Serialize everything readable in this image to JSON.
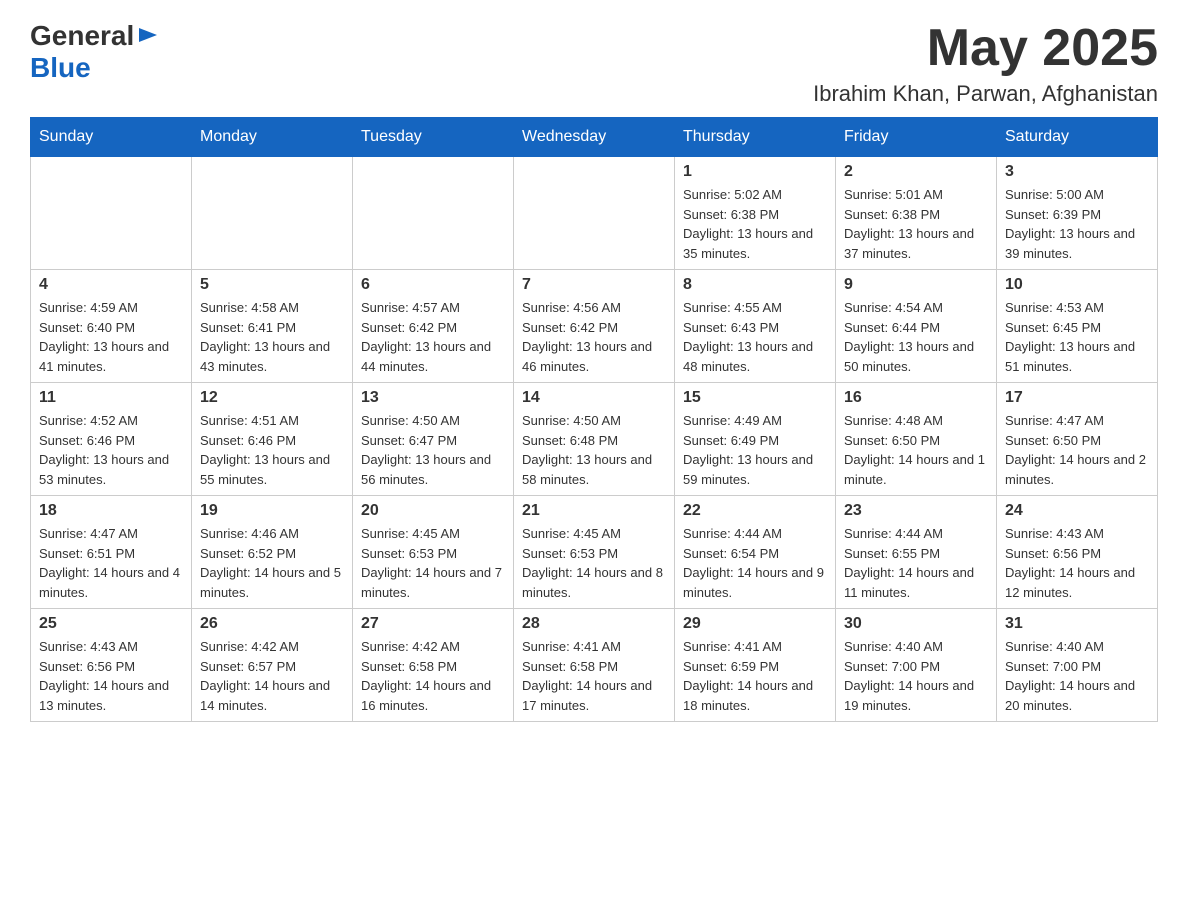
{
  "header": {
    "logo": {
      "text1": "General",
      "text2": "Blue"
    },
    "month": "May 2025",
    "location": "Ibrahim Khan, Parwan, Afghanistan"
  },
  "weekdays": [
    "Sunday",
    "Monday",
    "Tuesday",
    "Wednesday",
    "Thursday",
    "Friday",
    "Saturday"
  ],
  "weeks": [
    [
      {
        "day": "",
        "sunrise": "",
        "sunset": "",
        "daylight": ""
      },
      {
        "day": "",
        "sunrise": "",
        "sunset": "",
        "daylight": ""
      },
      {
        "day": "",
        "sunrise": "",
        "sunset": "",
        "daylight": ""
      },
      {
        "day": "",
        "sunrise": "",
        "sunset": "",
        "daylight": ""
      },
      {
        "day": "1",
        "sunrise": "Sunrise: 5:02 AM",
        "sunset": "Sunset: 6:38 PM",
        "daylight": "Daylight: 13 hours and 35 minutes."
      },
      {
        "day": "2",
        "sunrise": "Sunrise: 5:01 AM",
        "sunset": "Sunset: 6:38 PM",
        "daylight": "Daylight: 13 hours and 37 minutes."
      },
      {
        "day": "3",
        "sunrise": "Sunrise: 5:00 AM",
        "sunset": "Sunset: 6:39 PM",
        "daylight": "Daylight: 13 hours and 39 minutes."
      }
    ],
    [
      {
        "day": "4",
        "sunrise": "Sunrise: 4:59 AM",
        "sunset": "Sunset: 6:40 PM",
        "daylight": "Daylight: 13 hours and 41 minutes."
      },
      {
        "day": "5",
        "sunrise": "Sunrise: 4:58 AM",
        "sunset": "Sunset: 6:41 PM",
        "daylight": "Daylight: 13 hours and 43 minutes."
      },
      {
        "day": "6",
        "sunrise": "Sunrise: 4:57 AM",
        "sunset": "Sunset: 6:42 PM",
        "daylight": "Daylight: 13 hours and 44 minutes."
      },
      {
        "day": "7",
        "sunrise": "Sunrise: 4:56 AM",
        "sunset": "Sunset: 6:42 PM",
        "daylight": "Daylight: 13 hours and 46 minutes."
      },
      {
        "day": "8",
        "sunrise": "Sunrise: 4:55 AM",
        "sunset": "Sunset: 6:43 PM",
        "daylight": "Daylight: 13 hours and 48 minutes."
      },
      {
        "day": "9",
        "sunrise": "Sunrise: 4:54 AM",
        "sunset": "Sunset: 6:44 PM",
        "daylight": "Daylight: 13 hours and 50 minutes."
      },
      {
        "day": "10",
        "sunrise": "Sunrise: 4:53 AM",
        "sunset": "Sunset: 6:45 PM",
        "daylight": "Daylight: 13 hours and 51 minutes."
      }
    ],
    [
      {
        "day": "11",
        "sunrise": "Sunrise: 4:52 AM",
        "sunset": "Sunset: 6:46 PM",
        "daylight": "Daylight: 13 hours and 53 minutes."
      },
      {
        "day": "12",
        "sunrise": "Sunrise: 4:51 AM",
        "sunset": "Sunset: 6:46 PM",
        "daylight": "Daylight: 13 hours and 55 minutes."
      },
      {
        "day": "13",
        "sunrise": "Sunrise: 4:50 AM",
        "sunset": "Sunset: 6:47 PM",
        "daylight": "Daylight: 13 hours and 56 minutes."
      },
      {
        "day": "14",
        "sunrise": "Sunrise: 4:50 AM",
        "sunset": "Sunset: 6:48 PM",
        "daylight": "Daylight: 13 hours and 58 minutes."
      },
      {
        "day": "15",
        "sunrise": "Sunrise: 4:49 AM",
        "sunset": "Sunset: 6:49 PM",
        "daylight": "Daylight: 13 hours and 59 minutes."
      },
      {
        "day": "16",
        "sunrise": "Sunrise: 4:48 AM",
        "sunset": "Sunset: 6:50 PM",
        "daylight": "Daylight: 14 hours and 1 minute."
      },
      {
        "day": "17",
        "sunrise": "Sunrise: 4:47 AM",
        "sunset": "Sunset: 6:50 PM",
        "daylight": "Daylight: 14 hours and 2 minutes."
      }
    ],
    [
      {
        "day": "18",
        "sunrise": "Sunrise: 4:47 AM",
        "sunset": "Sunset: 6:51 PM",
        "daylight": "Daylight: 14 hours and 4 minutes."
      },
      {
        "day": "19",
        "sunrise": "Sunrise: 4:46 AM",
        "sunset": "Sunset: 6:52 PM",
        "daylight": "Daylight: 14 hours and 5 minutes."
      },
      {
        "day": "20",
        "sunrise": "Sunrise: 4:45 AM",
        "sunset": "Sunset: 6:53 PM",
        "daylight": "Daylight: 14 hours and 7 minutes."
      },
      {
        "day": "21",
        "sunrise": "Sunrise: 4:45 AM",
        "sunset": "Sunset: 6:53 PM",
        "daylight": "Daylight: 14 hours and 8 minutes."
      },
      {
        "day": "22",
        "sunrise": "Sunrise: 4:44 AM",
        "sunset": "Sunset: 6:54 PM",
        "daylight": "Daylight: 14 hours and 9 minutes."
      },
      {
        "day": "23",
        "sunrise": "Sunrise: 4:44 AM",
        "sunset": "Sunset: 6:55 PM",
        "daylight": "Daylight: 14 hours and 11 minutes."
      },
      {
        "day": "24",
        "sunrise": "Sunrise: 4:43 AM",
        "sunset": "Sunset: 6:56 PM",
        "daylight": "Daylight: 14 hours and 12 minutes."
      }
    ],
    [
      {
        "day": "25",
        "sunrise": "Sunrise: 4:43 AM",
        "sunset": "Sunset: 6:56 PM",
        "daylight": "Daylight: 14 hours and 13 minutes."
      },
      {
        "day": "26",
        "sunrise": "Sunrise: 4:42 AM",
        "sunset": "Sunset: 6:57 PM",
        "daylight": "Daylight: 14 hours and 14 minutes."
      },
      {
        "day": "27",
        "sunrise": "Sunrise: 4:42 AM",
        "sunset": "Sunset: 6:58 PM",
        "daylight": "Daylight: 14 hours and 16 minutes."
      },
      {
        "day": "28",
        "sunrise": "Sunrise: 4:41 AM",
        "sunset": "Sunset: 6:58 PM",
        "daylight": "Daylight: 14 hours and 17 minutes."
      },
      {
        "day": "29",
        "sunrise": "Sunrise: 4:41 AM",
        "sunset": "Sunset: 6:59 PM",
        "daylight": "Daylight: 14 hours and 18 minutes."
      },
      {
        "day": "30",
        "sunrise": "Sunrise: 4:40 AM",
        "sunset": "Sunset: 7:00 PM",
        "daylight": "Daylight: 14 hours and 19 minutes."
      },
      {
        "day": "31",
        "sunrise": "Sunrise: 4:40 AM",
        "sunset": "Sunset: 7:00 PM",
        "daylight": "Daylight: 14 hours and 20 minutes."
      }
    ]
  ]
}
